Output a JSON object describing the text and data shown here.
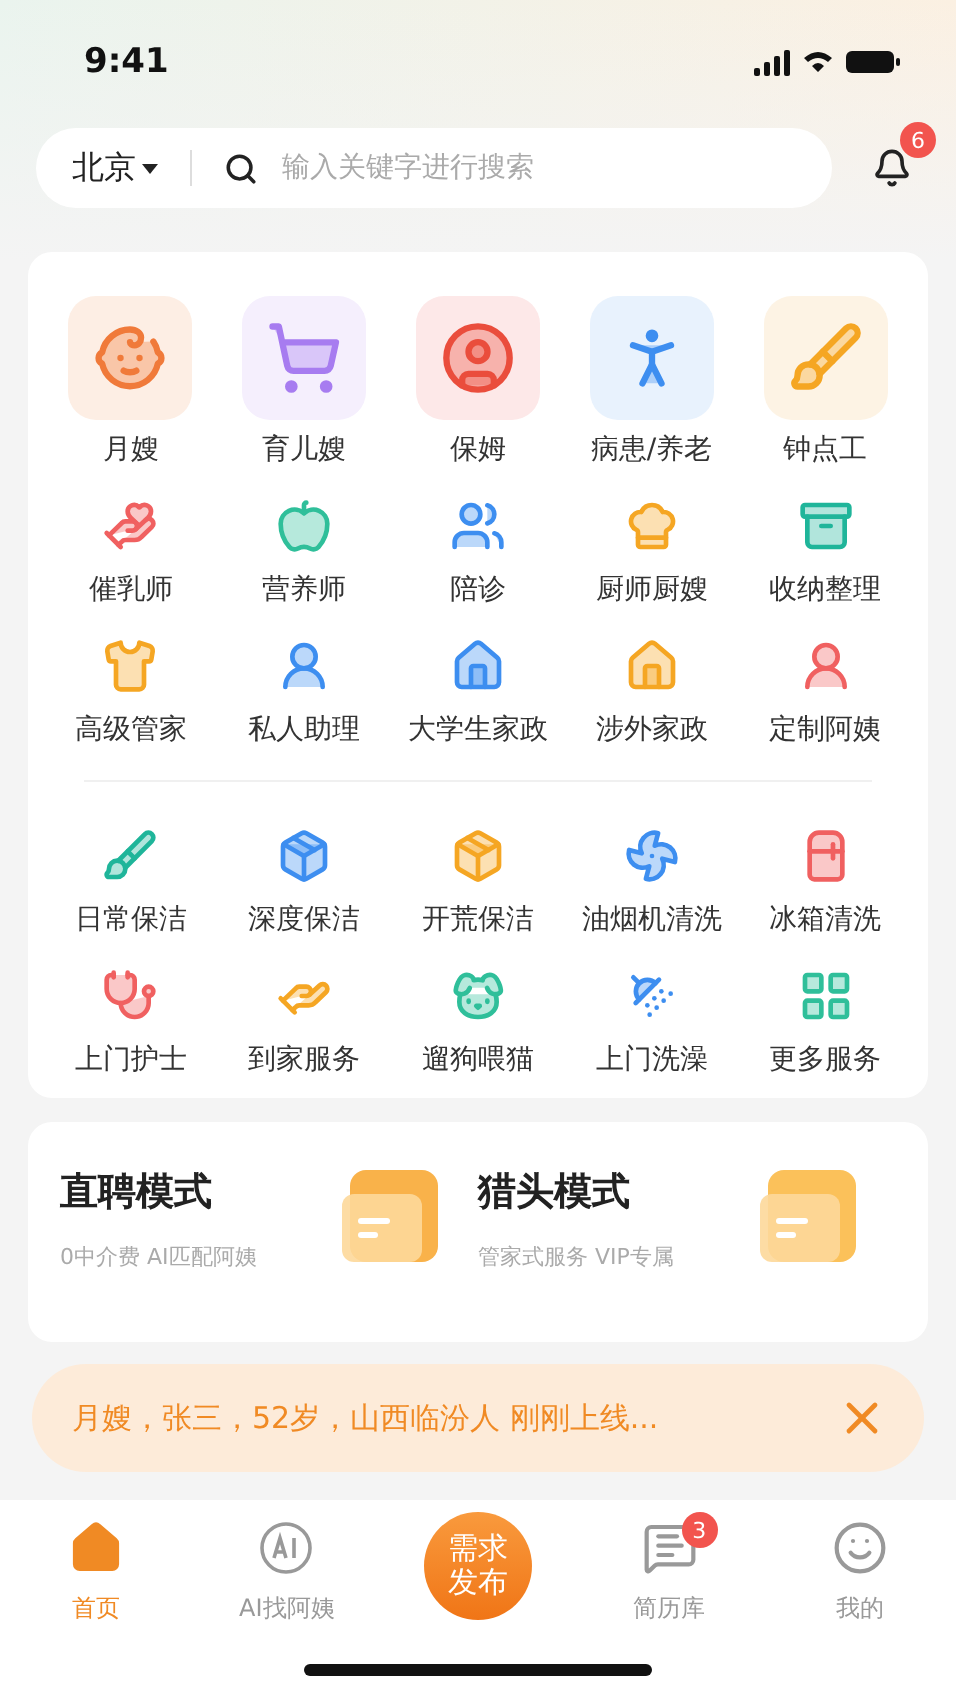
{
  "status_bar": {
    "time": "9:41"
  },
  "header": {
    "city": "北京",
    "search": {
      "placeholder": "输入关键字进行搜索"
    },
    "notification_badge": "6"
  },
  "services": {
    "groups": [
      {
        "items": [
          {
            "label": "月嫂",
            "kind": "tile"
          },
          {
            "label": "育儿嫂",
            "kind": "tile"
          },
          {
            "label": "保姆",
            "kind": "tile"
          },
          {
            "label": "病患/养老",
            "kind": "tile"
          },
          {
            "label": "钟点工",
            "kind": "tile"
          },
          {
            "label": "催乳师",
            "kind": "small"
          },
          {
            "label": "营养师",
            "kind": "small"
          },
          {
            "label": "陪诊",
            "kind": "small"
          },
          {
            "label": "厨师厨嫂",
            "kind": "small"
          },
          {
            "label": "收纳整理",
            "kind": "small"
          },
          {
            "label": "高级管家",
            "kind": "small"
          },
          {
            "label": "私人助理",
            "kind": "small"
          },
          {
            "label": "大学生家政",
            "kind": "small"
          },
          {
            "label": "涉外家政",
            "kind": "small"
          },
          {
            "label": "定制阿姨",
            "kind": "small"
          }
        ]
      },
      {
        "items": [
          {
            "label": "日常保洁",
            "kind": "small"
          },
          {
            "label": "深度保洁",
            "kind": "small"
          },
          {
            "label": "开荒保洁",
            "kind": "small"
          },
          {
            "label": "油烟机清洗",
            "kind": "small"
          },
          {
            "label": "冰箱清洗",
            "kind": "small"
          },
          {
            "label": "上门护士",
            "kind": "small"
          },
          {
            "label": "到家服务",
            "kind": "small"
          },
          {
            "label": "遛狗喂猫",
            "kind": "small"
          },
          {
            "label": "上门洗澡",
            "kind": "small"
          },
          {
            "label": "更多服务",
            "kind": "small"
          }
        ]
      }
    ]
  },
  "modes": [
    {
      "title": "直聘模式",
      "subtitle": "0中介费 AI匹配阿姨"
    },
    {
      "title": "猎头模式",
      "subtitle": "管家式服务 VIP专属"
    }
  ],
  "toast": {
    "text": "月嫂，张三，52岁，山西临汾人 刚刚上线..."
  },
  "bottom_nav": {
    "items": [
      {
        "label": "首页",
        "selected": true
      },
      {
        "label": "AI找阿姨",
        "selected": false
      },
      {
        "label": "需求发布",
        "kind": "center"
      },
      {
        "label": "简历库",
        "selected": false,
        "badge": "3"
      },
      {
        "label": "我的",
        "selected": false
      }
    ]
  }
}
